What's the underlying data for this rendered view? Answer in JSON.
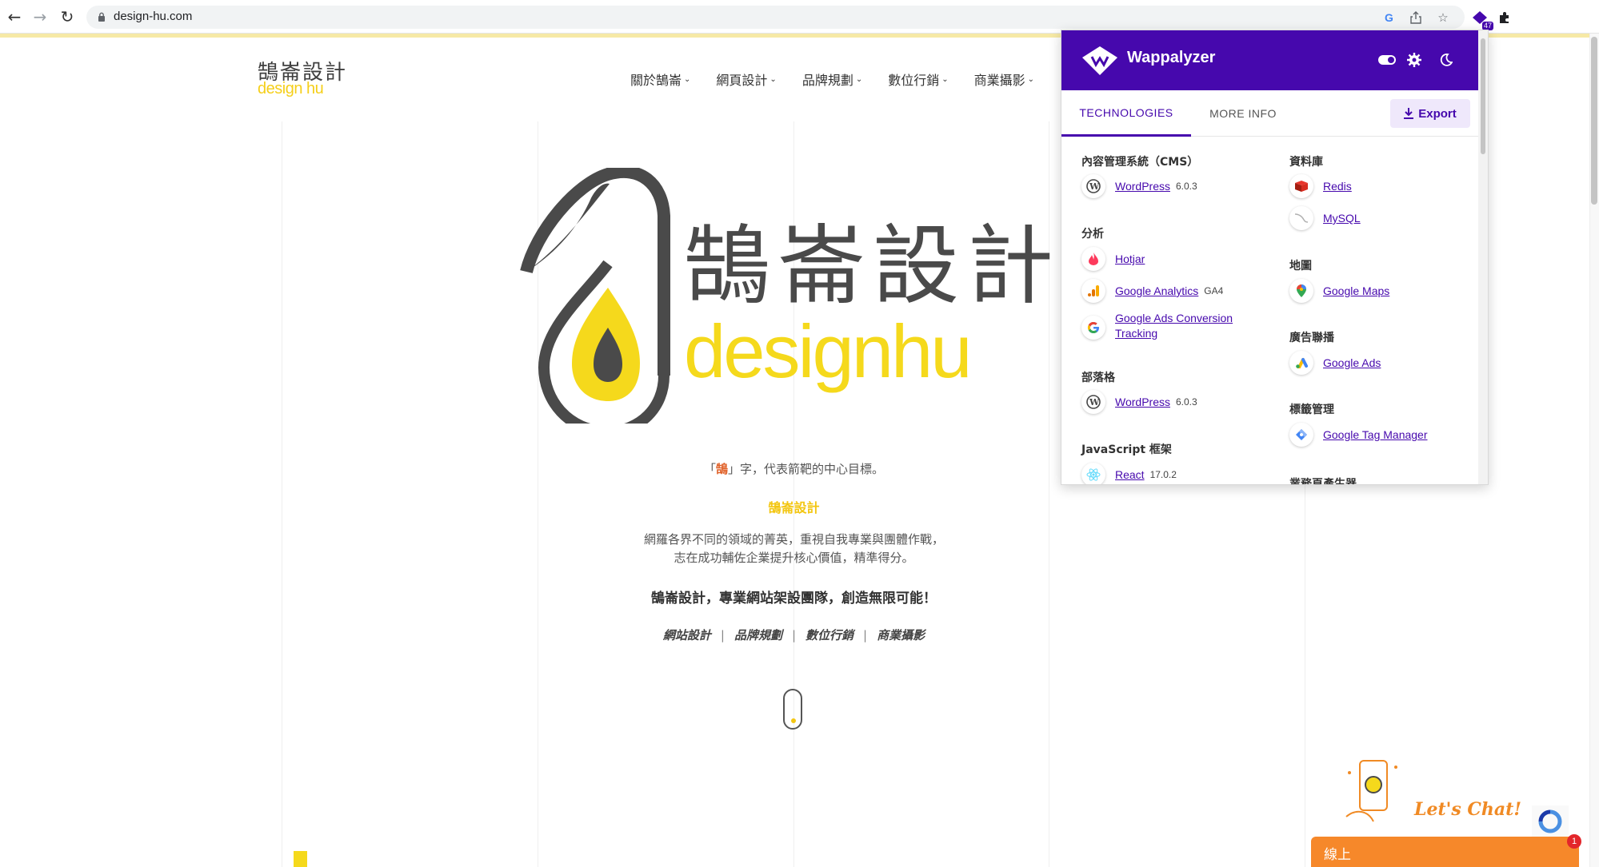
{
  "browser": {
    "url": "design-hu.com",
    "extension_badge": "47"
  },
  "site": {
    "logo_cn": "鵠崙設計",
    "logo_en": "design hu",
    "nav": [
      {
        "label": "關於鵠崙"
      },
      {
        "label": "網頁設計"
      },
      {
        "label": "品牌規劃"
      },
      {
        "label": "數位行銷"
      },
      {
        "label": "商業攝影"
      }
    ],
    "hero": {
      "title_cn": "鵠崙設計",
      "title_en": "designhu"
    },
    "tagline_pre": "「",
    "tagline_highlight": "鵠",
    "tagline_post": "」字，代表箭靶的中心目標。",
    "brand_name": "鵠崙設計",
    "desc_line1": "網羅各界不同的領域的菁英，重視自我專業與團體作戰，",
    "desc_line2": "志在成功輔佐企業提升核心價值，精準得分。",
    "slogan": "鵠崙設計，專業網站架設團隊，創造無限可能！",
    "services": [
      "網站設計",
      "品牌規劃",
      "數位行銷",
      "商業攝影"
    ],
    "service_separator": "|",
    "chat": {
      "title": "Let's Chat!",
      "status": "線上",
      "badge": "1"
    }
  },
  "wappalyzer": {
    "name": "Wappalyzer",
    "tabs": {
      "technologies": "TECHNOLOGIES",
      "more_info": "MORE INFO"
    },
    "export_label": "Export",
    "left_column": [
      {
        "category": "內容管理系統（CMS）",
        "items": [
          {
            "name": "WordPress",
            "version": "6.0.3",
            "icon": "wordpress-icon"
          }
        ]
      },
      {
        "category": "分析",
        "items": [
          {
            "name": "Hotjar",
            "version": "",
            "icon": "hotjar-icon"
          },
          {
            "name": "Google Analytics",
            "version": "GA4",
            "icon": "google-analytics-icon"
          },
          {
            "name": "Google Ads Conversion Tracking",
            "version": "",
            "icon": "google-icon"
          }
        ]
      },
      {
        "category": "部落格",
        "items": [
          {
            "name": "WordPress",
            "version": "6.0.3",
            "icon": "wordpress-icon"
          }
        ]
      },
      {
        "category": "JavaScript 框架",
        "items": [
          {
            "name": "React",
            "version": "17.0.2",
            "icon": "react-icon"
          }
        ]
      }
    ],
    "right_column": [
      {
        "category": "資料庫",
        "items": [
          {
            "name": "Redis",
            "version": "",
            "icon": "redis-icon"
          },
          {
            "name": "MySQL",
            "version": "",
            "icon": "mysql-icon"
          }
        ]
      },
      {
        "category": "地圖",
        "items": [
          {
            "name": "Google Maps",
            "version": "",
            "icon": "google-maps-icon"
          }
        ]
      },
      {
        "category": "廣告聯播",
        "items": [
          {
            "name": "Google Ads",
            "version": "",
            "icon": "google-ads-icon"
          }
        ]
      },
      {
        "category": "標籤管理",
        "items": [
          {
            "name": "Google Tag Manager",
            "version": "",
            "icon": "google-tag-manager-icon"
          }
        ]
      },
      {
        "category": "業務頁產生器",
        "items": []
      }
    ]
  },
  "colors": {
    "wappalyzer_purple": "#4608ad",
    "brand_yellow": "#f3c611",
    "brand_dark": "#4a4a4a",
    "chat_orange": "#f6882a"
  }
}
